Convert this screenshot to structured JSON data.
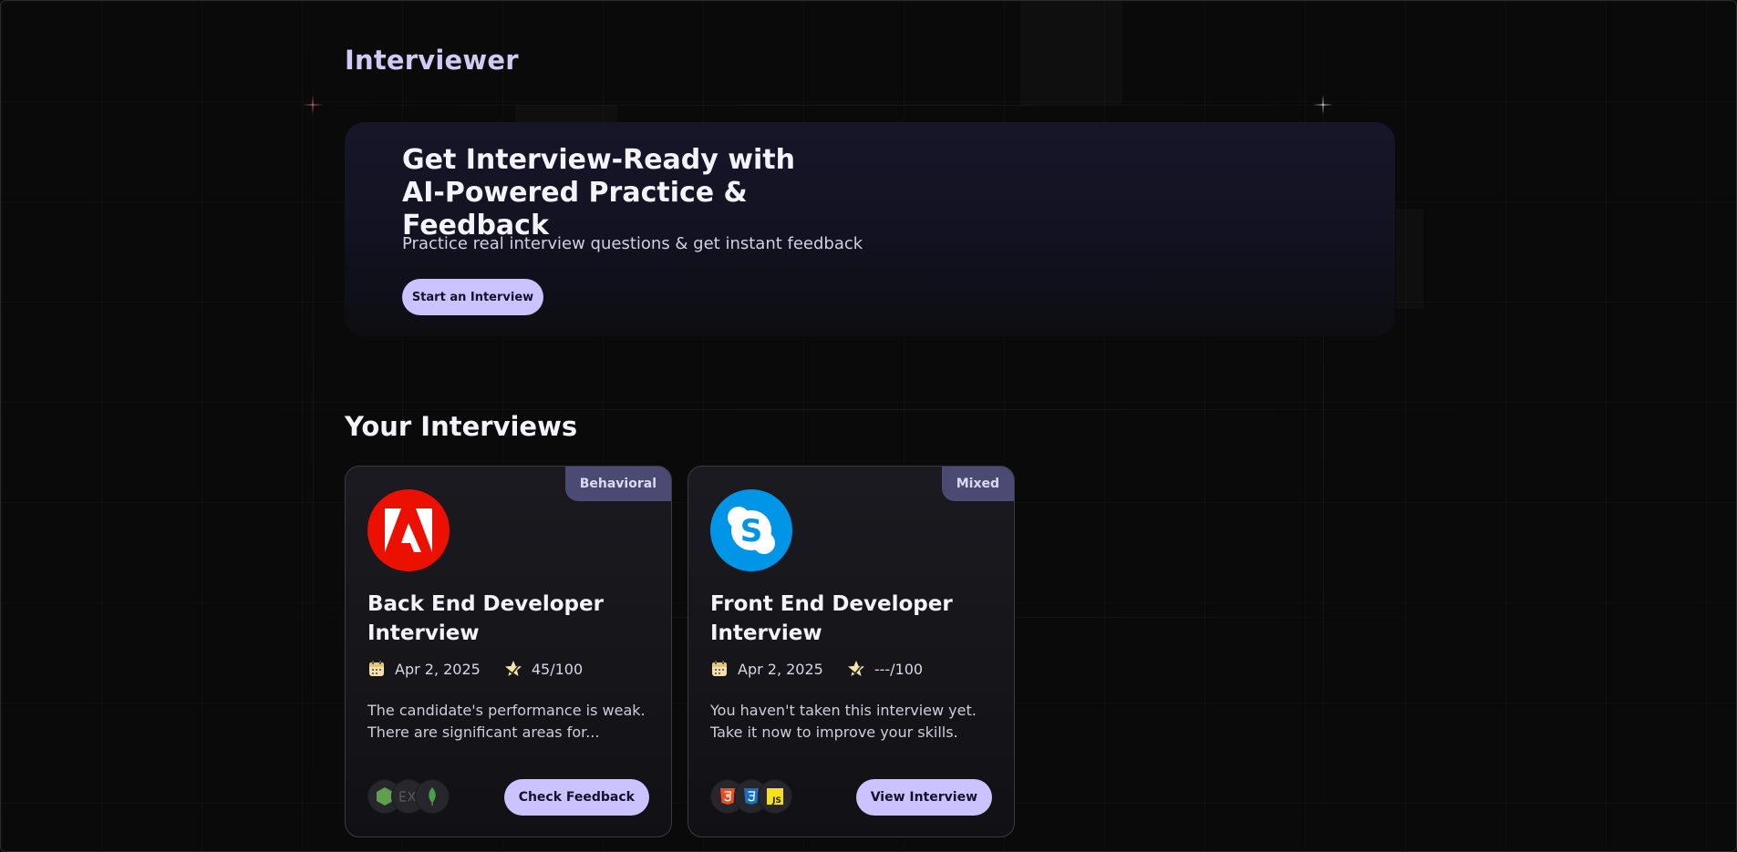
{
  "app": {
    "brand": "Interviewer"
  },
  "hero": {
    "title": "Get Interview-Ready with AI-Powered Practice & Feedback",
    "subtitle": "Practice real interview questions & get instant feedback",
    "cta_label": "Start an Interview"
  },
  "interviews": {
    "section_title": "Your Interviews",
    "cards": [
      {
        "badge": "Behavioral",
        "logo": "adobe-icon",
        "title": "Back End Developer Interview",
        "date": "Apr 2, 2025",
        "score": "45/100",
        "description": "The candidate's performance is weak. There are significant areas for...",
        "tech_stack": [
          "nodejs-icon",
          "express-icon",
          "mongodb-icon"
        ],
        "button_label": "Check Feedback"
      },
      {
        "badge": "Mixed",
        "logo": "skype-icon",
        "title": "Front End Developer Interview",
        "date": "Apr 2, 2025",
        "score": "---/100",
        "description": "You haven't taken this interview yet. Take it now to improve your skills.",
        "tech_stack": [
          "html5-icon",
          "css3-icon",
          "javascript-icon"
        ],
        "button_label": "View Interview"
      }
    ]
  },
  "colors": {
    "accent": "#cbc3ff",
    "badge_bg": "#4a4a72",
    "adobe_red": "#eb1000",
    "skype_blue": "#0095e6"
  }
}
